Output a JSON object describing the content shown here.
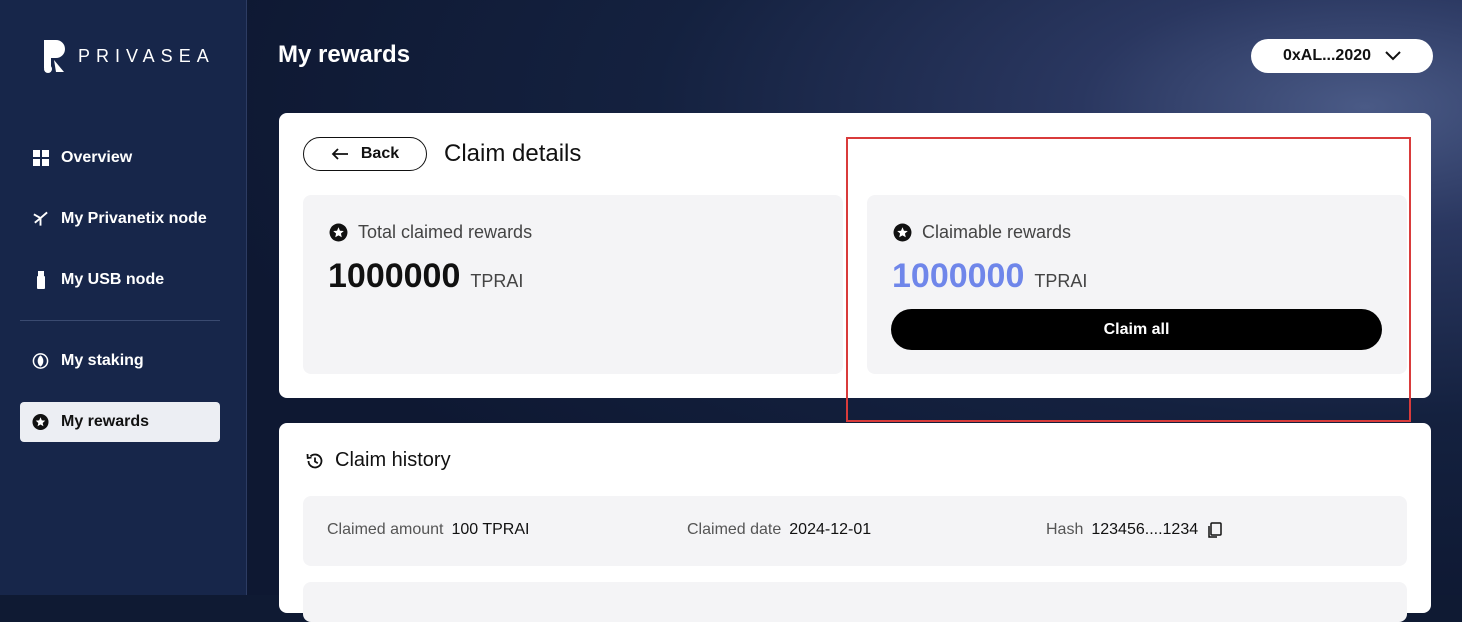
{
  "brand": {
    "name": "PRIVASEA"
  },
  "sidebar": {
    "items": [
      {
        "label": "Overview",
        "icon": "grid-icon"
      },
      {
        "label": "My Privanetix node",
        "icon": "node-icon"
      },
      {
        "label": "My USB node",
        "icon": "usb-icon"
      },
      {
        "label": "My staking",
        "icon": "staking-icon"
      },
      {
        "label": "My rewards",
        "icon": "reward-icon",
        "active": true
      }
    ]
  },
  "header": {
    "title": "My rewards",
    "wallet": "0xAL...2020"
  },
  "claim": {
    "back_label": "Back",
    "title": "Claim details",
    "total": {
      "label": "Total claimed rewards",
      "value": "1000000",
      "unit": "TPRAI"
    },
    "claimable": {
      "label": "Claimable rewards",
      "value": "1000000",
      "unit": "TPRAI",
      "button": "Claim all"
    }
  },
  "history": {
    "title": "Claim history",
    "rows": [
      {
        "amount_label": "Claimed amount",
        "amount": "100 TPRAI",
        "date_label": "Claimed date",
        "date": "2024-12-01",
        "hash_label": "Hash",
        "hash": "123456....1234"
      }
    ]
  },
  "colors": {
    "accent": "#6f86ea",
    "highlight": "#d93b3b",
    "sidebar": "#17264a"
  }
}
